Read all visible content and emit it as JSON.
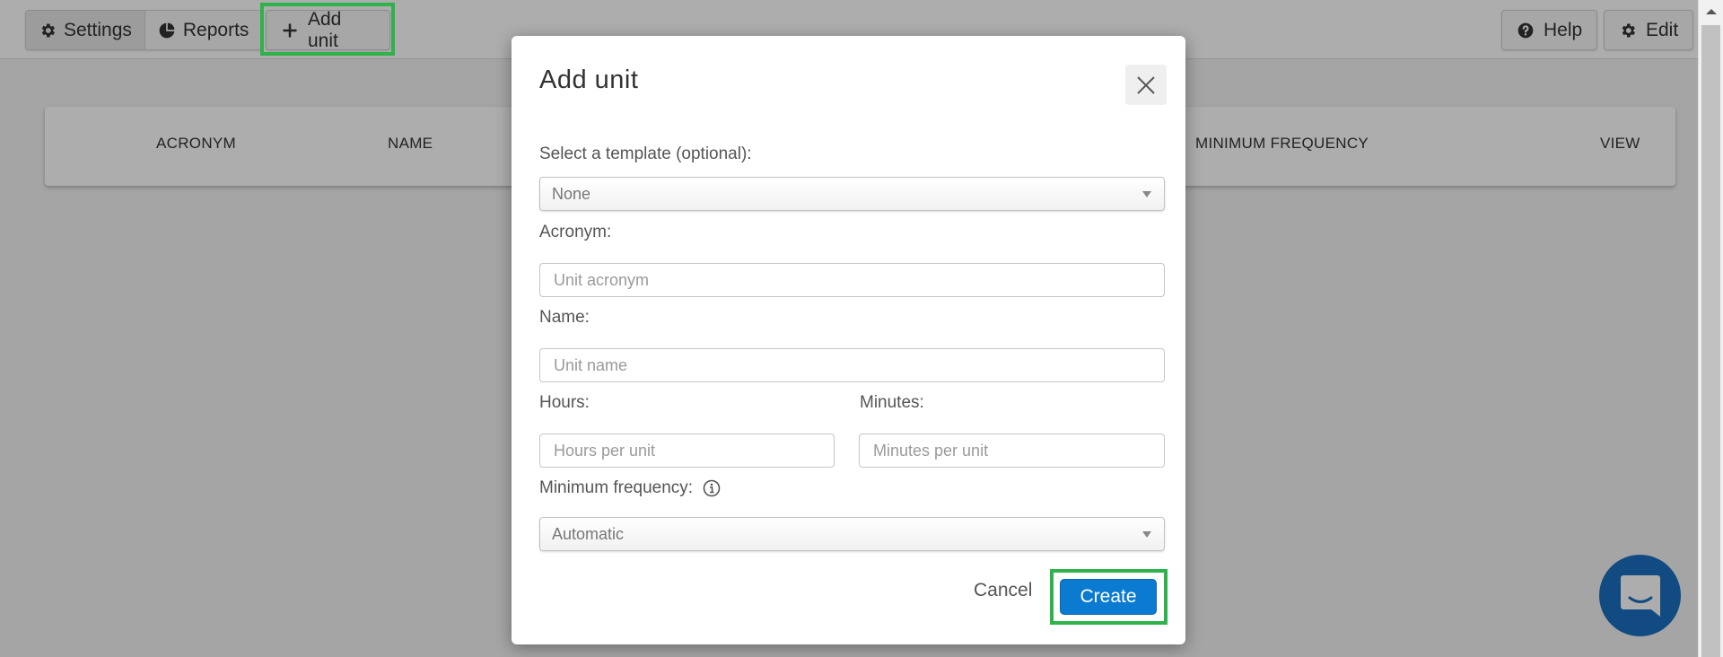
{
  "toolbar": {
    "settings_label": "Settings",
    "reports_label": "Reports",
    "add_unit_label": "Add unit",
    "help_label": "Help",
    "edit_label": "Edit"
  },
  "table": {
    "columns": [
      "ACRONYM",
      "NAME",
      "MINIMUM FREQUENCY",
      "VIEW"
    ]
  },
  "dialog": {
    "title": "Add unit",
    "template_label": "Select a template (optional):",
    "template_value": "None",
    "acronym_label": "Acronym:",
    "acronym_placeholder": "Unit acronym",
    "name_label": "Name:",
    "name_placeholder": "Unit name",
    "hours_label": "Hours:",
    "hours_placeholder": "Hours per unit",
    "minutes_label": "Minutes:",
    "minutes_placeholder": "Minutes per unit",
    "min_frequency_label": "Minimum frequency:",
    "min_frequency_value": "Automatic",
    "cancel_label": "Cancel",
    "create_label": "Create"
  },
  "colors": {
    "primary": "#0b7ad1",
    "highlight": "#2db34a",
    "chat": "#1a6fc0"
  }
}
